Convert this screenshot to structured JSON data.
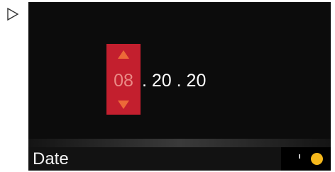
{
  "controls": {
    "play_icon": "play-triangle-icon"
  },
  "date_picker": {
    "month": "08",
    "rest": ". 20 . 20",
    "increment_icon": "arrow-up-icon",
    "decrement_icon": "arrow-down-icon",
    "active_field_color": "#c31f2e",
    "arrow_color": "#ec6a38"
  },
  "footer": {
    "label": "Date",
    "status_color": "#f5b81c"
  }
}
